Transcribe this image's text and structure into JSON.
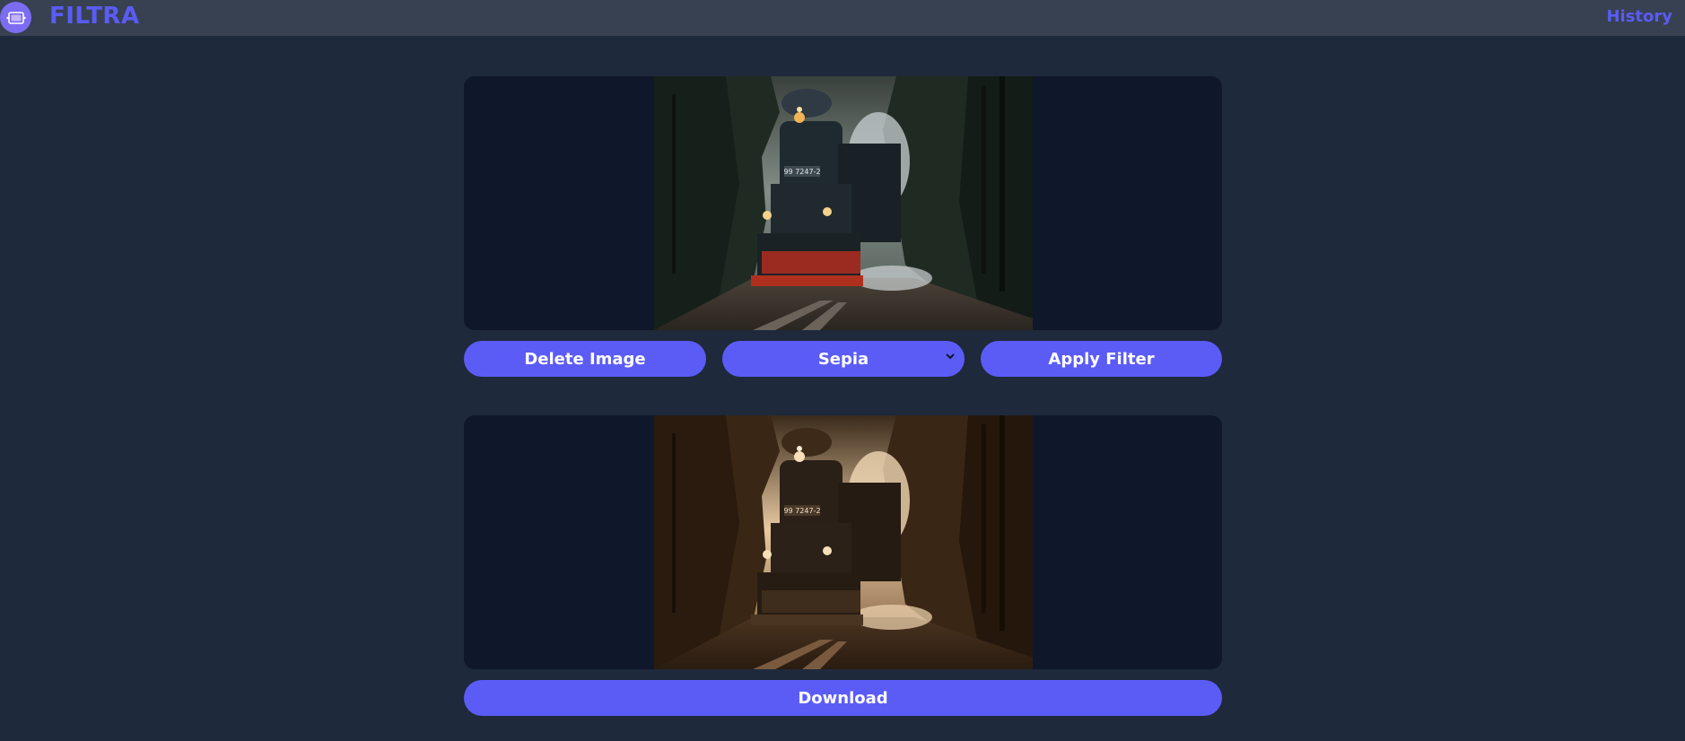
{
  "app": {
    "brand": "FILTRA",
    "nav_history": "History"
  },
  "editor": {
    "delete_label": "Delete Image",
    "filter_selected": "Sepia",
    "apply_label": "Apply Filter",
    "download_label": "Download"
  },
  "images": {
    "original": {
      "plate": "99 7247-2"
    },
    "filtered": {
      "plate": "99 7247-2"
    }
  }
}
